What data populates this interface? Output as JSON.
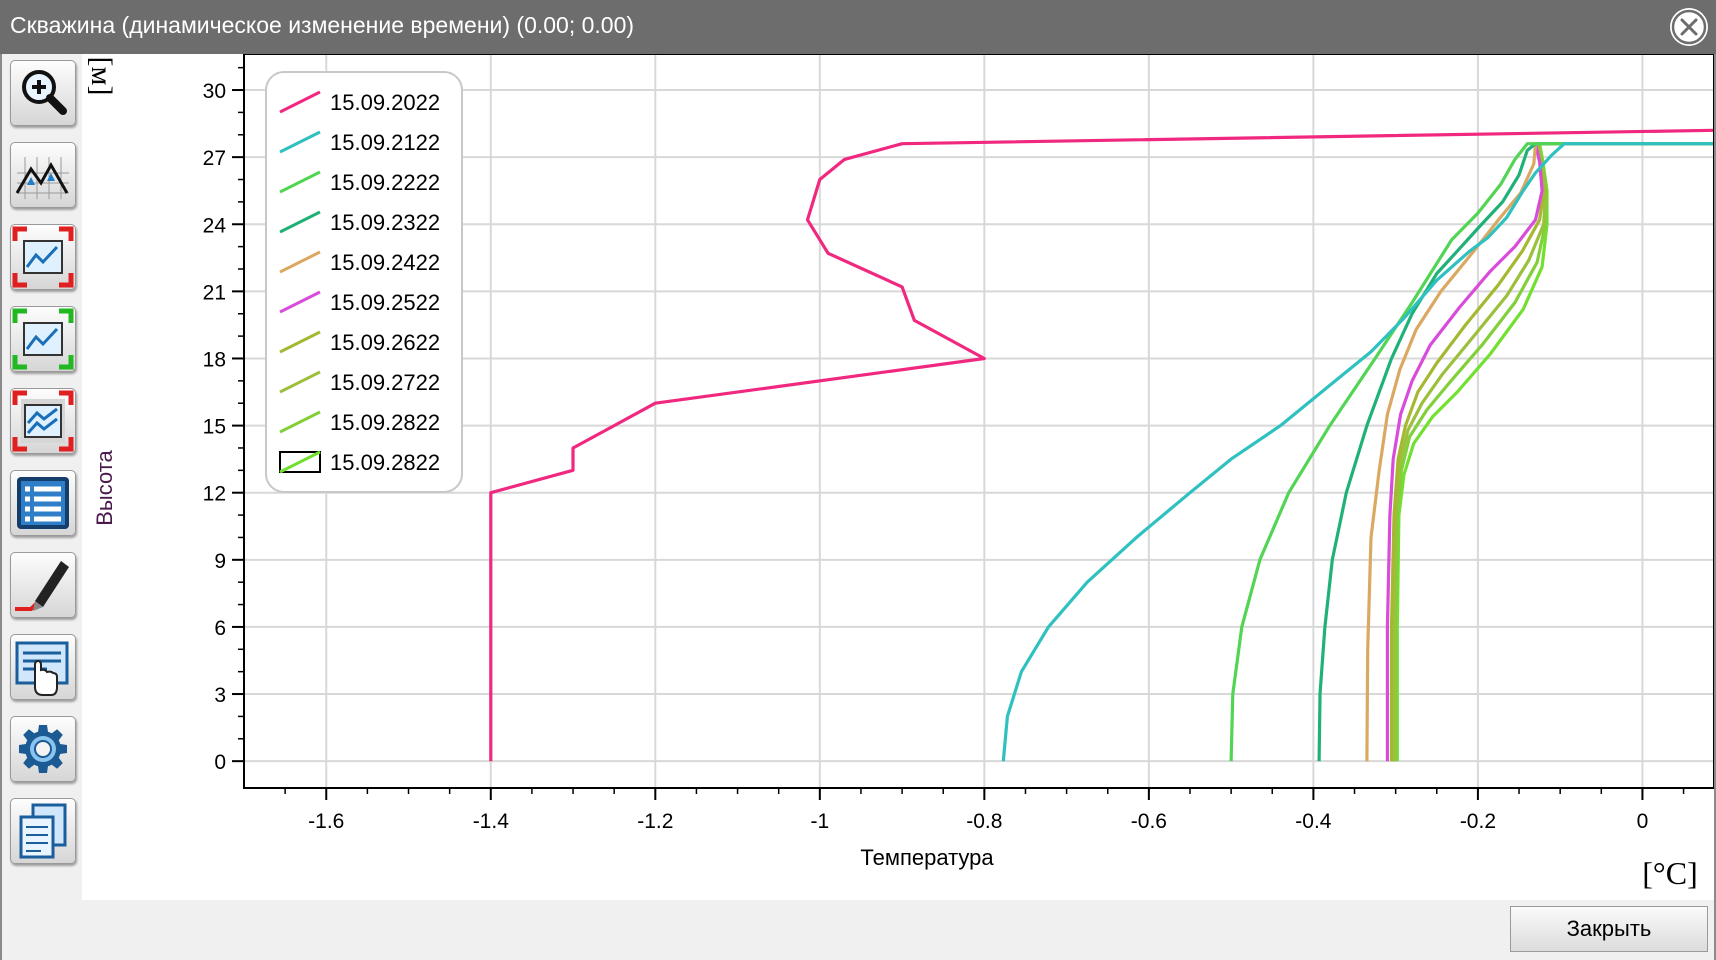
{
  "window": {
    "title": "Скважина (динамическое изменение времени) (0.00; 0.00)"
  },
  "toolbar": [
    {
      "name": "zoom-button",
      "icon": "zoom-in-icon"
    },
    {
      "name": "peaks-button",
      "icon": "mountain-chart-icon"
    },
    {
      "name": "zoom-out-frame-button",
      "icon": "chart-frame-red-icon"
    },
    {
      "name": "zoom-in-frame-button",
      "icon": "chart-frame-green-icon"
    },
    {
      "name": "multi-chart-button",
      "icon": "multi-chart-icon"
    },
    {
      "name": "list-button",
      "icon": "list-icon"
    },
    {
      "name": "edit-button",
      "icon": "pen-icon"
    },
    {
      "name": "select-table-button",
      "icon": "hand-pointer-icon"
    },
    {
      "name": "settings-button",
      "icon": "gear-icon"
    },
    {
      "name": "copy-button",
      "icon": "copy-icon"
    }
  ],
  "footer": {
    "close_label": "Закрыть"
  },
  "chart_data": {
    "type": "line",
    "xlabel": "Температура",
    "ylabel": "Высота",
    "x_unit": "[°C]",
    "y_unit": "[м]",
    "xlim": [
      -1.7,
      0.087
    ],
    "ylim": [
      -1.2,
      31.7
    ],
    "x_ticks": [
      -1.6,
      -1.4,
      -1.2,
      -1,
      -0.8,
      -0.6,
      -0.4,
      -0.2,
      0
    ],
    "y_ticks": [
      0,
      3,
      6,
      9,
      12,
      15,
      18,
      21,
      24,
      27,
      30
    ],
    "grid": true,
    "legend": "top-left",
    "series": [
      {
        "name": "15.09.2022",
        "color": "#f0287f",
        "points": [
          [
            -1.4,
            0
          ],
          [
            -1.4,
            12
          ],
          [
            -1.3,
            13
          ],
          [
            -1.3,
            14
          ],
          [
            -1.25,
            15
          ],
          [
            -1.2,
            16
          ],
          [
            -0.8,
            18
          ],
          [
            -0.885,
            19.7
          ],
          [
            -0.9,
            21.2
          ],
          [
            -0.99,
            22.7
          ],
          [
            -1.015,
            24.2
          ],
          [
            -1.0,
            26
          ],
          [
            -0.97,
            26.9
          ],
          [
            -0.9,
            27.6
          ],
          [
            0.087,
            28.2
          ]
        ]
      },
      {
        "name": "15.09.2122",
        "color": "#2fc0c0",
        "points": [
          [
            -0.777,
            0
          ],
          [
            -0.772,
            2
          ],
          [
            -0.755,
            4
          ],
          [
            -0.722,
            6
          ],
          [
            -0.675,
            8
          ],
          [
            -0.615,
            10
          ],
          [
            -0.55,
            12
          ],
          [
            -0.5,
            13.5
          ],
          [
            -0.44,
            15
          ],
          [
            -0.39,
            16.5
          ],
          [
            -0.33,
            18.3
          ],
          [
            -0.29,
            19.8
          ],
          [
            -0.25,
            21.5
          ],
          [
            -0.21,
            22.8
          ],
          [
            -0.188,
            23.4
          ],
          [
            -0.165,
            24.3
          ],
          [
            -0.145,
            25.5
          ],
          [
            -0.13,
            26.3
          ],
          [
            -0.11,
            27.1
          ],
          [
            -0.095,
            27.6
          ],
          [
            -0.02,
            27.6
          ],
          [
            0.087,
            27.6
          ]
        ]
      },
      {
        "name": "15.09.2222",
        "color": "#52d454",
        "points": [
          [
            -0.5,
            0
          ],
          [
            -0.498,
            3
          ],
          [
            -0.487,
            6
          ],
          [
            -0.465,
            9
          ],
          [
            -0.43,
            12
          ],
          [
            -0.38,
            15
          ],
          [
            -0.325,
            18
          ],
          [
            -0.28,
            20.5
          ],
          [
            -0.232,
            23.3
          ],
          [
            -0.2,
            24.5
          ],
          [
            -0.172,
            25.8
          ],
          [
            -0.155,
            26.9
          ],
          [
            -0.14,
            27.6
          ],
          [
            0.087,
            27.6
          ]
        ]
      },
      {
        "name": "15.09.2322",
        "color": "#1fb178",
        "points": [
          [
            -0.393,
            0
          ],
          [
            -0.392,
            3
          ],
          [
            -0.386,
            6
          ],
          [
            -0.377,
            9
          ],
          [
            -0.36,
            12
          ],
          [
            -0.335,
            15
          ],
          [
            -0.305,
            18
          ],
          [
            -0.28,
            20
          ],
          [
            -0.25,
            21.8
          ],
          [
            -0.225,
            22.8
          ],
          [
            -0.198,
            23.9
          ],
          [
            -0.17,
            25
          ],
          [
            -0.15,
            26.2
          ],
          [
            -0.14,
            27.3
          ],
          [
            -0.13,
            27.6
          ],
          [
            0.087,
            27.6
          ]
        ]
      },
      {
        "name": "15.09.2422",
        "color": "#dba862",
        "points": [
          [
            -0.335,
            0
          ],
          [
            -0.334,
            5
          ],
          [
            -0.33,
            10
          ],
          [
            -0.32,
            13
          ],
          [
            -0.31,
            15.5
          ],
          [
            -0.295,
            17.5
          ],
          [
            -0.275,
            19.3
          ],
          [
            -0.245,
            21
          ],
          [
            -0.205,
            22.8
          ],
          [
            -0.175,
            24.2
          ],
          [
            -0.148,
            25.4
          ],
          [
            -0.132,
            26.7
          ],
          [
            -0.13,
            27.6
          ],
          [
            0.087,
            27.6
          ]
        ]
      },
      {
        "name": "15.09.2522",
        "color": "#d94bd9",
        "points": [
          [
            -0.31,
            0
          ],
          [
            -0.31,
            6
          ],
          [
            -0.307,
            11
          ],
          [
            -0.303,
            13.5
          ],
          [
            -0.294,
            15.5
          ],
          [
            -0.28,
            17
          ],
          [
            -0.258,
            18.6
          ],
          [
            -0.222,
            20.3
          ],
          [
            -0.185,
            21.9
          ],
          [
            -0.155,
            23
          ],
          [
            -0.13,
            24.2
          ],
          [
            -0.122,
            25.5
          ],
          [
            -0.125,
            26.8
          ],
          [
            -0.13,
            27.6
          ],
          [
            0.087,
            27.6
          ]
        ]
      },
      {
        "name": "15.09.2622",
        "color": "#a6b832",
        "points": [
          [
            -0.305,
            0
          ],
          [
            -0.305,
            6
          ],
          [
            -0.302,
            11
          ],
          [
            -0.297,
            13.5
          ],
          [
            -0.288,
            15
          ],
          [
            -0.273,
            16.5
          ],
          [
            -0.25,
            17.8
          ],
          [
            -0.215,
            19.5
          ],
          [
            -0.175,
            21.3
          ],
          [
            -0.146,
            22.8
          ],
          [
            -0.125,
            24.2
          ],
          [
            -0.12,
            25.5
          ],
          [
            -0.125,
            26.8
          ],
          [
            -0.13,
            27.6
          ],
          [
            0.087,
            27.6
          ]
        ]
      },
      {
        "name": "15.09.2722",
        "color": "#9cc03c",
        "points": [
          [
            -0.302,
            0
          ],
          [
            -0.302,
            6
          ],
          [
            -0.3,
            11
          ],
          [
            -0.295,
            13.3
          ],
          [
            -0.285,
            14.8
          ],
          [
            -0.268,
            16
          ],
          [
            -0.243,
            17.3
          ],
          [
            -0.205,
            19
          ],
          [
            -0.165,
            20.8
          ],
          [
            -0.138,
            22.4
          ],
          [
            -0.12,
            24
          ],
          [
            -0.118,
            25.5
          ],
          [
            -0.123,
            26.8
          ],
          [
            -0.128,
            27.6
          ],
          [
            0.087,
            27.6
          ]
        ]
      },
      {
        "name": "15.09.2822",
        "color": "#82cf3a",
        "points": [
          [
            -0.3,
            0
          ],
          [
            -0.3,
            6
          ],
          [
            -0.298,
            11
          ],
          [
            -0.293,
            13
          ],
          [
            -0.283,
            14.5
          ],
          [
            -0.262,
            15.7
          ],
          [
            -0.235,
            16.9
          ],
          [
            -0.195,
            18.6
          ],
          [
            -0.155,
            20.5
          ],
          [
            -0.128,
            22.3
          ],
          [
            -0.118,
            24
          ],
          [
            -0.117,
            25.5
          ],
          [
            -0.122,
            26.8
          ],
          [
            -0.126,
            27.6
          ],
          [
            0.087,
            27.6
          ]
        ]
      },
      {
        "name": "15.09.2822",
        "color": "#72e02e",
        "boxed": true,
        "points": [
          [
            -0.298,
            0
          ],
          [
            -0.298,
            6
          ],
          [
            -0.296,
            11
          ],
          [
            -0.29,
            12.8
          ],
          [
            -0.278,
            14.2
          ],
          [
            -0.255,
            15.4
          ],
          [
            -0.225,
            16.5
          ],
          [
            -0.185,
            18.2
          ],
          [
            -0.145,
            20.2
          ],
          [
            -0.122,
            22.1
          ],
          [
            -0.116,
            24
          ],
          [
            -0.116,
            25.5
          ],
          [
            -0.121,
            26.8
          ],
          [
            -0.125,
            27.6
          ],
          [
            0.087,
            27.6
          ]
        ]
      }
    ]
  }
}
